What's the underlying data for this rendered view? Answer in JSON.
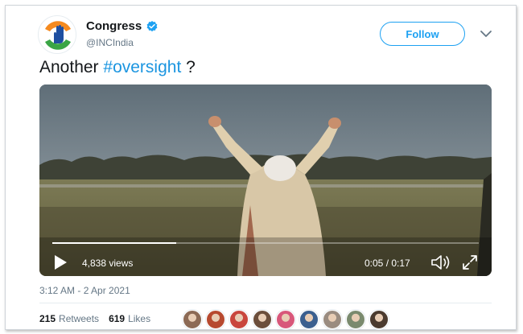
{
  "tweet": {
    "author_name": "Congress",
    "author_handle": "@INCIndia",
    "follow_label": "Follow",
    "text_prefix": "Another ",
    "hashtag": "#oversight",
    "text_suffix": " ?",
    "timestamp": "3:12 AM - 2 Apr 2021"
  },
  "video": {
    "views": "4,838 views",
    "time": "0:05 / 0:17",
    "progress_fraction": 0.29
  },
  "stats": {
    "retweets_count": "215",
    "retweets_label": "Retweets",
    "likes_count": "619",
    "likes_label": "Likes"
  },
  "likers": [
    {
      "color": "#8c6a55"
    },
    {
      "color": "#b7492f"
    },
    {
      "color": "#c9463d"
    },
    {
      "color": "#6b4e3b"
    },
    {
      "color": "#d8577a"
    },
    {
      "color": "#3a5f8f"
    },
    {
      "color": "#9a8c80"
    },
    {
      "color": "#7a8a6e"
    },
    {
      "color": "#4b3b2f"
    }
  ],
  "colors": {
    "accent": "#1da1f2",
    "hashtag": "#1b95e0",
    "verified": "#1da1f2"
  }
}
